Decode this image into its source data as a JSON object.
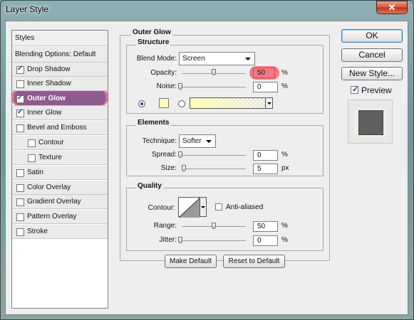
{
  "window": {
    "title": "Layer Style",
    "close_glyph": "✕"
  },
  "styles_panel": {
    "header": "Styles",
    "blending": "Blending Options: Default",
    "items": [
      {
        "label": "Drop Shadow",
        "checked": true
      },
      {
        "label": "Inner Shadow",
        "checked": false
      },
      {
        "label": "Outer Glow",
        "checked": true,
        "selected": true
      },
      {
        "label": "Inner Glow",
        "checked": true
      },
      {
        "label": "Bevel and Emboss",
        "checked": false
      },
      {
        "label": "Contour",
        "checked": false,
        "indent": true
      },
      {
        "label": "Texture",
        "checked": false,
        "indent": true
      },
      {
        "label": "Satin",
        "checked": false
      },
      {
        "label": "Color Overlay",
        "checked": false
      },
      {
        "label": "Gradient Overlay",
        "checked": false
      },
      {
        "label": "Pattern Overlay",
        "checked": false
      },
      {
        "label": "Stroke",
        "checked": false
      }
    ]
  },
  "outer_glow": {
    "title": "Outer Glow",
    "structure": {
      "title": "Structure",
      "blend_mode_label": "Blend Mode:",
      "blend_mode_value": "Screen",
      "opacity_label": "Opacity:",
      "opacity_value": "50",
      "opacity_unit": "%",
      "noise_label": "Noise:",
      "noise_value": "0",
      "noise_unit": "%",
      "glow_color": "#fffdb8",
      "mode": "color"
    },
    "elements": {
      "title": "Elements",
      "technique_label": "Technique:",
      "technique_value": "Softer",
      "spread_label": "Spread:",
      "spread_value": "0",
      "spread_unit": "%",
      "size_label": "Size:",
      "size_value": "5",
      "size_unit": "px"
    },
    "quality": {
      "title": "Quality",
      "contour_label": "Contour:",
      "anti_aliased_label": "Anti-aliased",
      "anti_aliased": false,
      "range_label": "Range:",
      "range_value": "50",
      "range_unit": "%",
      "jitter_label": "Jitter:",
      "jitter_value": "0",
      "jitter_unit": "%"
    },
    "make_default": "Make Default",
    "reset_default": "Reset to Default"
  },
  "actions": {
    "ok": "OK",
    "cancel": "Cancel",
    "new_style": "New Style...",
    "preview_label": "Preview",
    "preview_checked": true
  },
  "colors": {
    "highlight": "#d65a86",
    "opacity_highlight": "#f06a7a",
    "glow": "#fffdb8"
  }
}
